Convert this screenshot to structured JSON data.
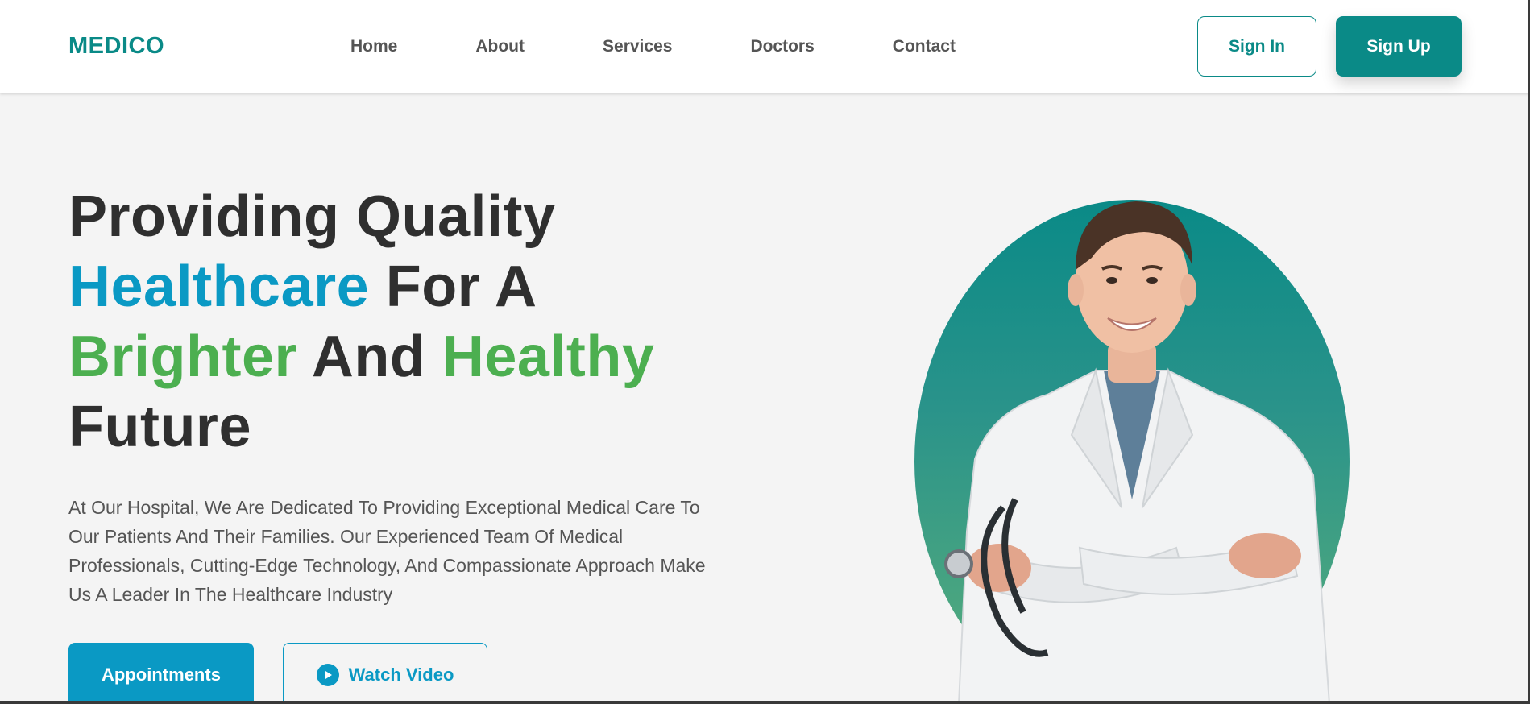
{
  "brand": {
    "logo": "MEDICO",
    "accent": "#0a8a87",
    "blue": "#0a99c4",
    "green": "#4caf50"
  },
  "nav": {
    "links": [
      "Home",
      "About",
      "Services",
      "Doctors",
      "Contact"
    ],
    "sign_in": "Sign In",
    "sign_up": "Sign Up"
  },
  "hero": {
    "headline": {
      "line1": "Providing Quality",
      "line2_blue": "Healthcare",
      "line2_rest": " For A",
      "line3_green_a": "Brighter",
      "line3_mid": " And ",
      "line3_green_b": "Healthy",
      "line4": "Future"
    },
    "description": "At Our Hospital, We Are Dedicated To Providing Exceptional Medical Care To Our Patients And Their Families. Our Experienced Team Of Medical Professionals, Cutting-Edge Technology, And Compassionate Approach Make Us A Leader In The Healthcare Industry",
    "appointments_label": "Appointments",
    "watch_video_label": "Watch Video",
    "watch_video_icon": "play-circle-icon",
    "image_subject": "doctor-portrait"
  }
}
